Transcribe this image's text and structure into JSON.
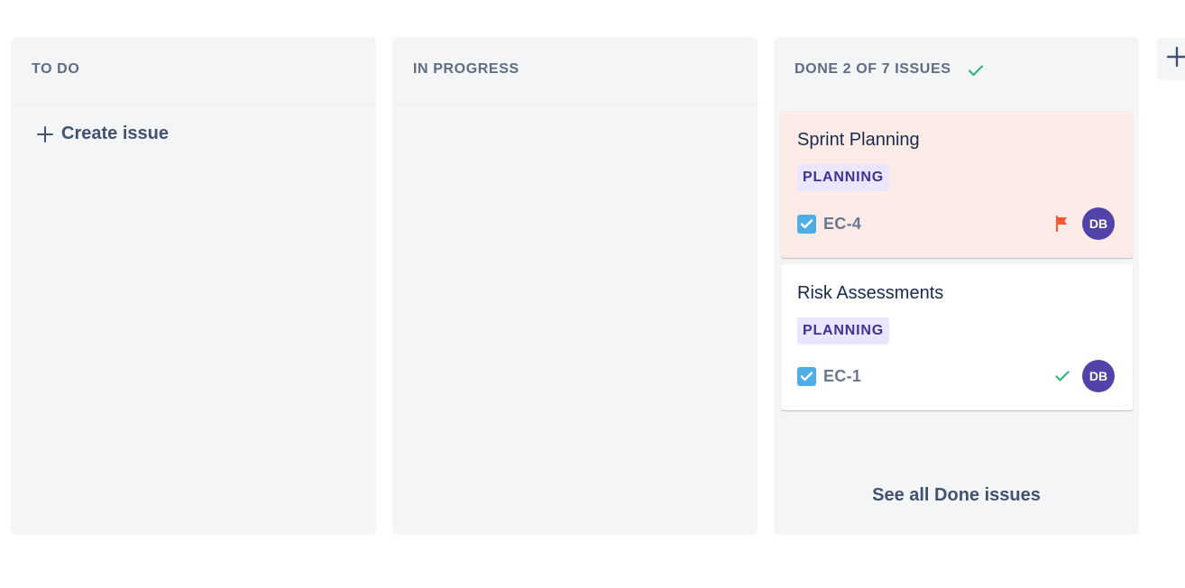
{
  "columns": {
    "todo": {
      "title": "TO DO",
      "create_label": "Create issue"
    },
    "in_progress": {
      "title": "IN PROGRESS"
    },
    "done": {
      "title": "DONE 2 OF 7 ISSUES",
      "see_all_label": "See all Done issues",
      "cards": [
        {
          "title": "Sprint Planning",
          "label": "PLANNING",
          "key": "EC-4",
          "status_icon": "flag-icon",
          "avatar_initials": "DB",
          "highlight": true
        },
        {
          "title": "Risk Assessments",
          "label": "PLANNING",
          "key": "EC-1",
          "status_icon": "check-icon",
          "avatar_initials": "DB",
          "highlight": false
        }
      ]
    }
  },
  "colors": {
    "column_bg": "#f4f5f7",
    "flagged_card_bg": "#fcebe6",
    "label_bg": "#eae6ff",
    "label_text": "#403294",
    "avatar_bg": "#5243aa",
    "done_check": "#36b37e",
    "flag": "#ff5630",
    "task_icon": "#4fade6"
  }
}
